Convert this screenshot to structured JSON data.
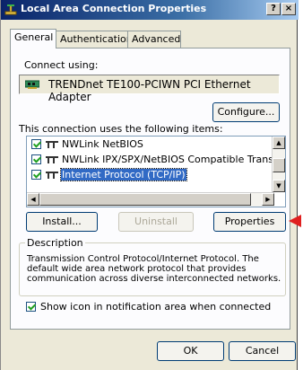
{
  "window": {
    "title": "Local Area Connection Properties",
    "help_button": "?",
    "close_button": "×"
  },
  "tabs": [
    {
      "label": "General",
      "active": true
    },
    {
      "label": "Authentication",
      "active": false
    },
    {
      "label": "Advanced",
      "active": false
    }
  ],
  "connect_using": {
    "label": "Connect using:",
    "adapter": "TRENDnet TE100-PCIWN PCI Ethernet Adapter",
    "configure_button": "Configure..."
  },
  "items": {
    "label": "This connection uses the following items:",
    "list": [
      {
        "label": "NWLink NetBIOS",
        "checked": true,
        "selected": false
      },
      {
        "label": "NWLink IPX/SPX/NetBIOS Compatible Transport Proto",
        "checked": true,
        "selected": false
      },
      {
        "label": "Internet Protocol (TCP/IP)",
        "checked": true,
        "selected": true
      }
    ]
  },
  "buttons": {
    "install": "Install...",
    "uninstall": "Uninstall",
    "properties": "Properties"
  },
  "description": {
    "title": "Description",
    "text": "Transmission Control Protocol/Internet Protocol. The default wide area network protocol that provides communication across diverse interconnected networks."
  },
  "show_icon": {
    "label": "Show icon in notification area when connected",
    "checked": true
  },
  "footer": {
    "ok": "OK",
    "cancel": "Cancel"
  },
  "colors": {
    "titlebar": "#0a246a",
    "selection": "#316ac5",
    "annotation_arrow": "#e02020"
  }
}
